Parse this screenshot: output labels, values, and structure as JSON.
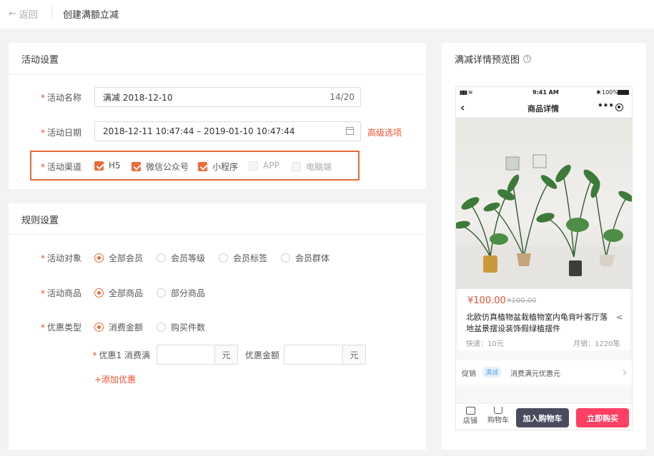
{
  "header": {
    "back_label": "返回",
    "page_title": "创建满额立减"
  },
  "activity": {
    "section_title": "活动设置",
    "name_label": "活动名称",
    "name_value": "满减  2018-12-10",
    "name_counter": "14/20",
    "date_label": "活动日期",
    "date_value": "2018-12-11 10:47:44 – 2019-01-10 10:47:44",
    "advanced_link": "高级选项",
    "channel_label": "活动渠道",
    "channels": [
      {
        "label": "H5",
        "checked": true
      },
      {
        "label": "微信公众号",
        "checked": true
      },
      {
        "label": "小程序",
        "checked": true
      },
      {
        "label": "APP",
        "checked": false
      },
      {
        "label": "电脑端",
        "checked": false
      }
    ]
  },
  "rules": {
    "section_title": "规则设置",
    "target_label": "活动对象",
    "targets": [
      "全部会员",
      "会员等级",
      "会员标签",
      "会员群体"
    ],
    "goods_label": "活动商品",
    "goods": [
      "全部商品",
      "部分商品"
    ],
    "type_label": "优惠类型",
    "types": [
      "消费金额",
      "购买件数"
    ],
    "tier_label": "优惠1 消费满",
    "unit": "元",
    "discount_label": "优惠金额",
    "add_link": "+添加优惠"
  },
  "preview": {
    "title": "满减详情预览图",
    "status_time": "9:41 AM",
    "battery": "100%",
    "nav_title": "商品详情",
    "price": "¥100.00",
    "old_price": "¥100.00",
    "product_name": "北欧仿真植物盆栽植物室内龟背叶客厅落地盆景摆设装饰假绿植摆件",
    "shipping": "快递：10元",
    "monthly_sales": "月销：1220笔",
    "promo_label": "促销",
    "promo_tag": "满减",
    "promo_text": "消费满元优惠元",
    "shop_label": "店铺",
    "cart_label": "购物车",
    "add_cart": "加入购物车",
    "buy_now": "立即购买"
  },
  "colors": {
    "accent": "#ee6a36",
    "highlight_border": "#ea6a3a",
    "buy_button": "#ff3f64",
    "cart_button": "#4a4b5e",
    "price": "#f04e2f"
  }
}
